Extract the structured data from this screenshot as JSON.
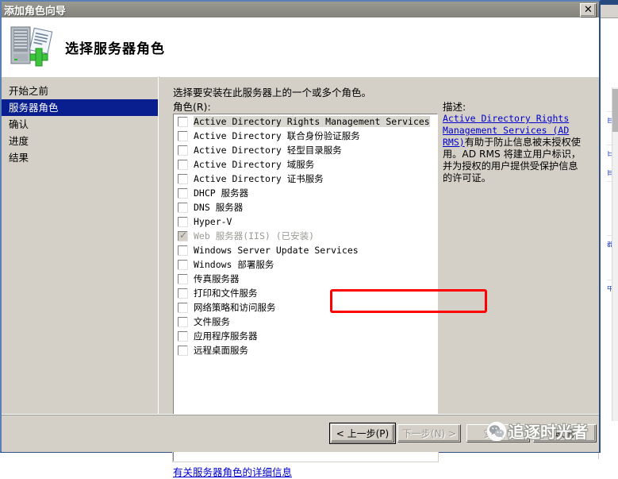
{
  "window": {
    "title": "添加角色向导",
    "close_label": "✕"
  },
  "header": {
    "title": "选择服务器角色",
    "icon": "server-add-icon"
  },
  "sidebar": {
    "items": [
      {
        "label": "开始之前",
        "selected": false
      },
      {
        "label": "服务器角色",
        "selected": true
      },
      {
        "label": "确认",
        "selected": false
      },
      {
        "label": "进度",
        "selected": false
      },
      {
        "label": "结果",
        "selected": false
      }
    ]
  },
  "content": {
    "intro_line1": "选择要安装在此服务器上的一个或多个角色。",
    "intro_line2": "角色(R):",
    "more_info_link": "有关服务器角色的详细信息"
  },
  "roles": [
    {
      "label": "Active Directory Rights Management Services",
      "checked": false,
      "disabled": false,
      "highlighted": true
    },
    {
      "label": "Active Directory 联合身份验证服务",
      "checked": false,
      "disabled": false,
      "highlighted": false
    },
    {
      "label": "Active Directory 轻型目录服务",
      "checked": false,
      "disabled": false,
      "highlighted": false
    },
    {
      "label": "Active Directory 域服务",
      "checked": false,
      "disabled": false,
      "highlighted": false
    },
    {
      "label": "Active Directory 证书服务",
      "checked": false,
      "disabled": false,
      "highlighted": false
    },
    {
      "label": "DHCP 服务器",
      "checked": false,
      "disabled": false,
      "highlighted": false
    },
    {
      "label": "DNS 服务器",
      "checked": false,
      "disabled": false,
      "highlighted": false
    },
    {
      "label": "Hyper-V",
      "checked": false,
      "disabled": false,
      "highlighted": false
    },
    {
      "label": "Web 服务器(IIS)  (已安装)",
      "checked": true,
      "disabled": true,
      "highlighted": false
    },
    {
      "label": "Windows Server Update Services",
      "checked": false,
      "disabled": false,
      "highlighted": false
    },
    {
      "label": "Windows 部署服务",
      "checked": false,
      "disabled": false,
      "highlighted": false
    },
    {
      "label": "传真服务器",
      "checked": false,
      "disabled": false,
      "highlighted": false
    },
    {
      "label": "打印和文件服务",
      "checked": false,
      "disabled": false,
      "highlighted": false
    },
    {
      "label": "网络策略和访问服务",
      "checked": false,
      "disabled": false,
      "highlighted": false
    },
    {
      "label": "文件服务",
      "checked": false,
      "disabled": false,
      "highlighted": false
    },
    {
      "label": "应用程序服务器",
      "checked": false,
      "disabled": false,
      "highlighted": false
    },
    {
      "label": "远程桌面服务",
      "checked": false,
      "disabled": false,
      "highlighted": false
    }
  ],
  "description": {
    "label": "描述:",
    "link_text": "Active Directory Rights Management Services (AD RMS)",
    "body_text": "有助于防止信息被未授权使用。AD RMS 将建立用户标识，并为授权的用户提供受保护信息的许可证。"
  },
  "footer": {
    "back": "< 上一步(P)",
    "next": "下一步(N) >",
    "install": "安装(I)",
    "cancel": "取消"
  },
  "annotation": {
    "highlight_color": "#fe0000",
    "target_role": "Web 服务器(IIS)  (已安装)"
  },
  "watermark": {
    "text": "追逐时光者",
    "logo": "wechat-logo"
  },
  "background_fragments": [
    "自",
    "日",
    "目",
    "器",
    "中"
  ]
}
